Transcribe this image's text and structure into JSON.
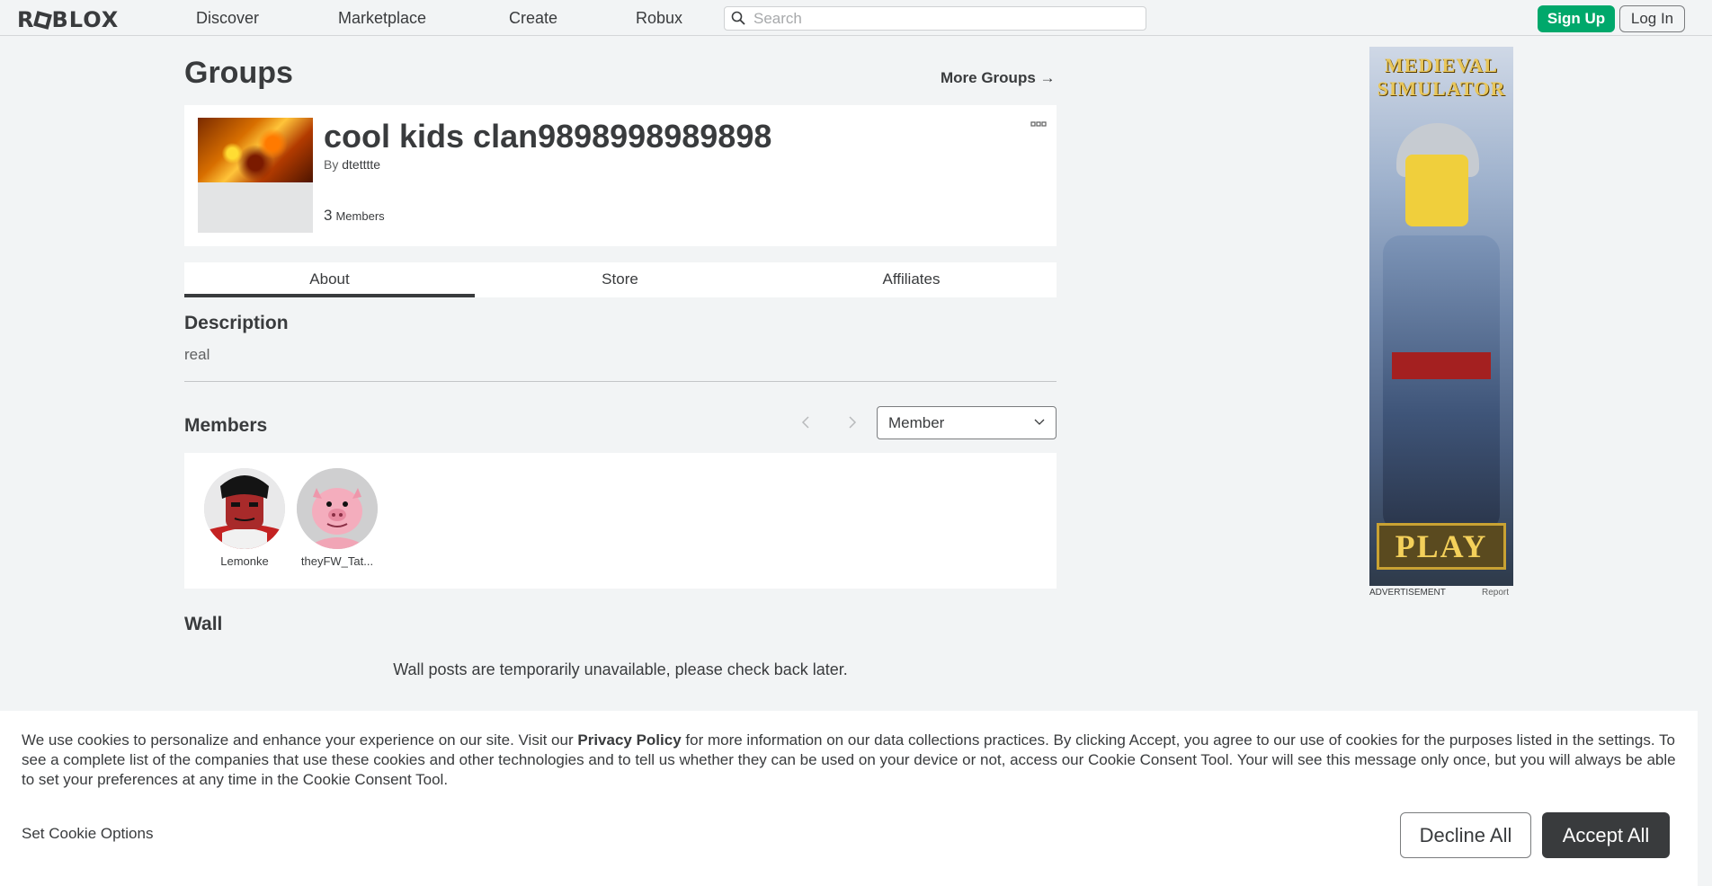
{
  "header": {
    "logo": "ROBLOX",
    "nav": [
      "Discover",
      "Marketplace",
      "Create",
      "Robux"
    ],
    "search_placeholder": "Search",
    "signup_label": "Sign Up",
    "login_label": "Log In"
  },
  "page": {
    "title": "Groups",
    "more_groups": "More Groups →"
  },
  "group": {
    "name": "cool kids clan9898998989898",
    "by_label": "By",
    "owner": "dtetttte",
    "member_count": "3",
    "member_label": "Members"
  },
  "tabs": [
    {
      "label": "About",
      "active": true
    },
    {
      "label": "Store",
      "active": false
    },
    {
      "label": "Affiliates",
      "active": false
    }
  ],
  "about": {
    "description_title": "Description",
    "description_text": "real",
    "members_title": "Members",
    "role_selected": "Member",
    "members": [
      {
        "name": "Lemonke"
      },
      {
        "name": "theyFW_Tat..."
      }
    ],
    "wall_title": "Wall",
    "wall_message": "Wall posts are temporarily unavailable, please check back later."
  },
  "ad": {
    "title": "MEDIEVAL SIMULATOR",
    "play": "PLAY",
    "label": "ADVERTISEMENT",
    "report": "Report"
  },
  "cookie": {
    "text_before": "We use cookies to personalize and enhance your experience on our site. Visit our ",
    "privacy_link": "Privacy Policy",
    "text_after": " for more information on our data collections practices. By clicking Accept, you agree to our use of cookies for the purposes listed in the settings. To see a complete list of the companies that use these cookies and other technologies and to tell us whether they can be used on your device or not, access our Cookie Consent Tool. Your will see this message only once, but you will always be able to set your preferences at any time in the Cookie Consent Tool.",
    "set_options": "Set Cookie Options",
    "decline": "Decline All",
    "accept": "Accept All"
  },
  "colors": {
    "accent_green": "#00a86b",
    "text_dark": "#393b3d",
    "page_bg": "#f2f4f5"
  }
}
